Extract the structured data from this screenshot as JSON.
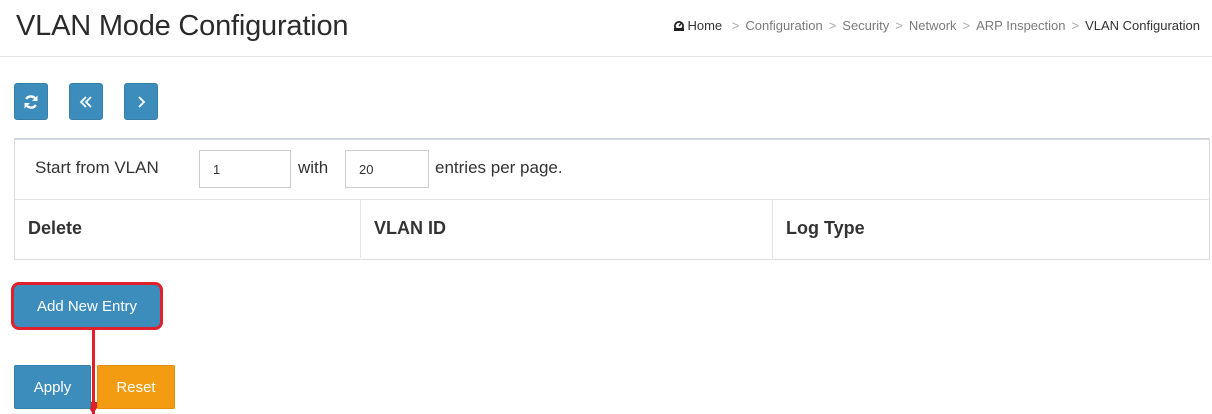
{
  "page": {
    "title": "VLAN Mode Configuration"
  },
  "breadcrumb": {
    "items": [
      "Home",
      "Configuration",
      "Security",
      "Network",
      "ARP Inspection",
      "VLAN Configuration"
    ],
    "separator": ">"
  },
  "toolbar": {
    "refresh_icon": "refresh-icon",
    "first_page_icon": "double-chevron-left-icon",
    "next_page_icon": "chevron-right-icon"
  },
  "filter": {
    "start_label": "Start from VLAN",
    "start_value": "1",
    "with_label": "with",
    "entries_value": "20",
    "entries_label": "entries per page."
  },
  "table": {
    "columns": [
      "Delete",
      "VLAN ID",
      "Log Type"
    ]
  },
  "actions": {
    "add_label": "Add New Entry",
    "apply_label": "Apply",
    "reset_label": "Reset"
  },
  "colors": {
    "primary": "#3c8dbc",
    "warning": "#f39c12",
    "highlight": "#e0202a"
  }
}
